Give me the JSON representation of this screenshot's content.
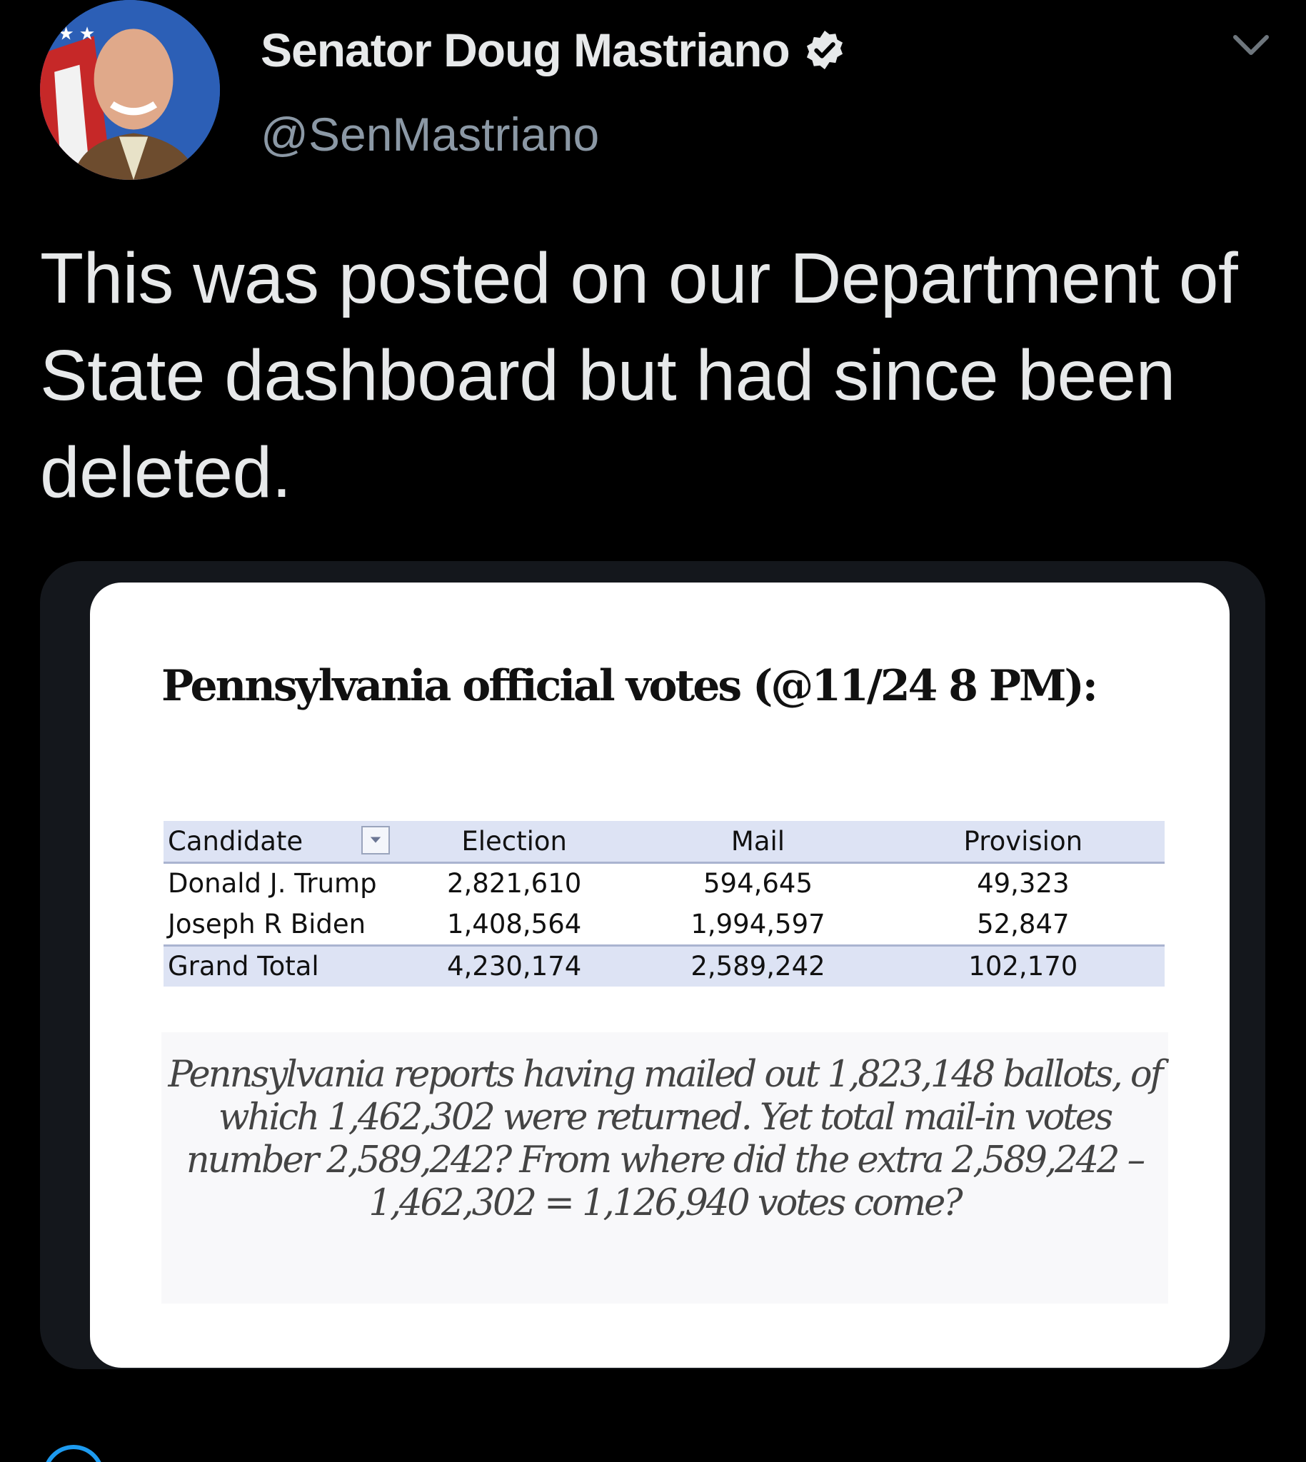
{
  "author": {
    "display_name": "Senator Doug Mastriano",
    "handle": "@SenMastriano",
    "verified_icon": "verified-badge-icon",
    "avatar_icon": "profile-photo"
  },
  "tweet": {
    "text": "This was posted on our Department of State dashboard but had since been deleted."
  },
  "media": {
    "title": "Pennsylvania official votes (@11/24 8 PM):",
    "table": {
      "headers": [
        "Candidate",
        "Election",
        "Mail",
        "Provision"
      ],
      "rows": [
        [
          "Donald J. Trump",
          "2,821,610",
          "594,645",
          "49,323"
        ],
        [
          "Joseph R Biden",
          "1,408,564",
          "1,994,597",
          "52,847"
        ]
      ],
      "total": [
        "Grand Total",
        "4,230,174",
        "2,589,242",
        "102,170"
      ]
    },
    "caption": "Pennsylvania reports having mailed out 1,823,148 ballots, of which 1,462,302 were returned. Yet total mail-in votes number 2,589,242? From where did the extra 2,589,242 – 1,462,302 = 1,126,940 votes come?"
  },
  "colors": {
    "background": "#000000",
    "text_primary": "#e7e9ea",
    "text_secondary": "#8b98a5",
    "card_border": "#14171c",
    "table_header": "#dde3f4",
    "accent": "#1d9bf0"
  }
}
